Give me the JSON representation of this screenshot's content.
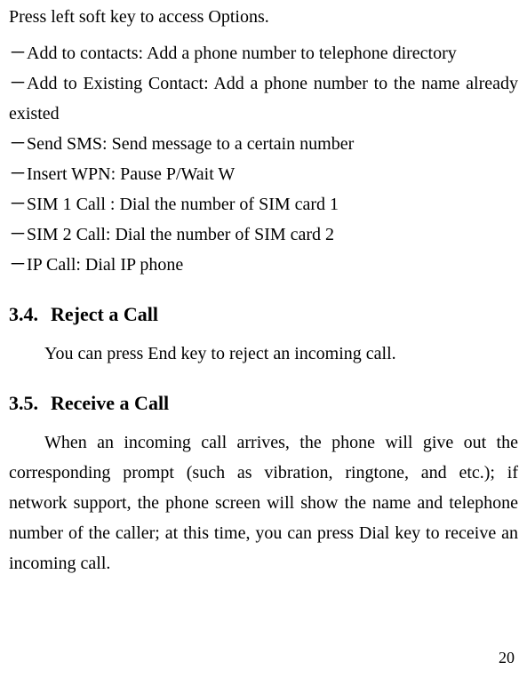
{
  "intro": "Press left soft key to access Options.",
  "options": {
    "dash": "－",
    "items": [
      "Add to contacts: Add a phone number to telephone directory",
      "Add to Existing Contact: Add a phone number to the name already existed",
      "Send SMS: Send message to a certain number",
      "Insert WPN: Pause P/Wait W",
      "SIM 1 Call : Dial the number of SIM card 1",
      "SIM 2 Call: Dial the number of SIM card 2",
      "IP Call: Dial IP phone"
    ]
  },
  "section1": {
    "num": "3.4.",
    "title": "Reject a Call",
    "body": "You can press End key to reject an incoming call."
  },
  "section2": {
    "num": "3.5.",
    "title": "Receive a Call",
    "body": "When an incoming call arrives, the phone will give out the corresponding prompt (such as vibration, ringtone, and etc.); if network support, the phone screen will show the name and telephone number of the caller; at this time, you can press Dial key to receive an incoming call."
  },
  "pageNumber": "20"
}
